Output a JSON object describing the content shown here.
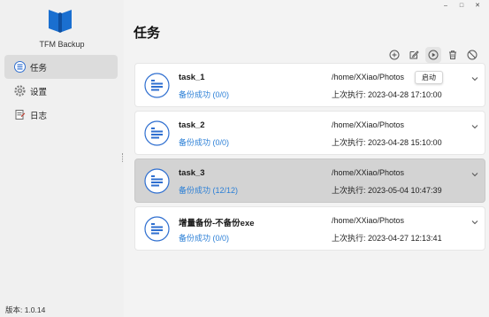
{
  "app": {
    "name": "TFM Backup",
    "version": "版本: 1.0.14",
    "brand_color": "#1a6fd0"
  },
  "window_controls": {
    "minimize": "–",
    "maximize": "□",
    "close": "✕"
  },
  "sidebar": {
    "items": [
      {
        "label": "任务",
        "icon": "tasks-icon",
        "active": true
      },
      {
        "label": "设置",
        "icon": "gear-icon",
        "active": false
      },
      {
        "label": "日志",
        "icon": "log-icon",
        "active": false
      }
    ]
  },
  "main": {
    "title": "任务",
    "toolbar": [
      "add-icon",
      "edit-icon",
      "play-icon",
      "delete-icon",
      "disable-icon"
    ]
  },
  "tasks": [
    {
      "name": "task_1",
      "status": "备份成功 (0/0)",
      "path": "/home/XXiao/Photos",
      "last_run": "上次执行: 2023-04-28 17:10:00",
      "selected": false
    },
    {
      "name": "task_2",
      "status": "备份成功 (0/0)",
      "path": "/home/XXiao/Photos",
      "last_run": "上次执行: 2023-04-28 15:10:00",
      "selected": false
    },
    {
      "name": "task_3",
      "status": "备份成功 (12/12)",
      "path": "/home/XXiao/Photos",
      "last_run": "上次执行: 2023-05-04 10:47:39",
      "selected": true
    },
    {
      "name": "增量备份-不备份exe",
      "status": "备份成功 (0/0)",
      "path": "/home/XXiao/Photos",
      "last_run": "上次执行: 2023-04-27 12:13:41",
      "selected": false
    }
  ],
  "tooltip": {
    "text": "启动"
  },
  "colors": {
    "status_blue": "#2b7fd6",
    "selected_bg": "#d3d3d3",
    "icon_blue": "#2f6fd0"
  }
}
